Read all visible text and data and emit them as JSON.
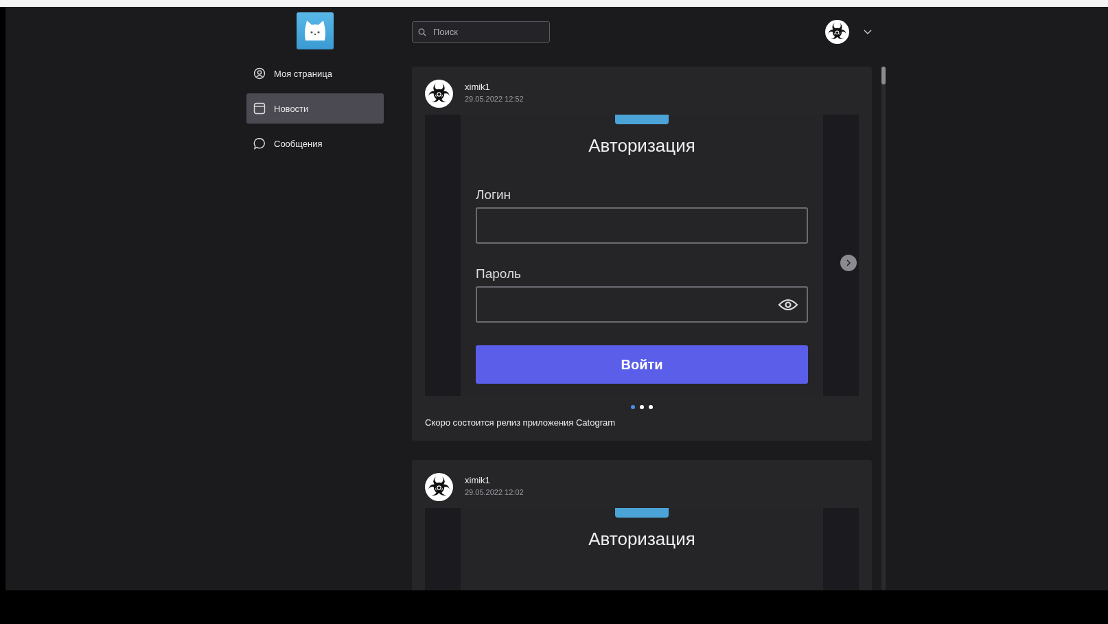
{
  "search": {
    "placeholder": "Поиск"
  },
  "sidebar": {
    "items": [
      {
        "label": "Моя страница",
        "selected": false
      },
      {
        "label": "Новости",
        "selected": true
      },
      {
        "label": "Сообщения",
        "selected": false
      }
    ]
  },
  "posts": [
    {
      "author": "ximik1",
      "date": "29.05.2022 12:52",
      "slide": {
        "title": "Авторизация",
        "fields": [
          {
            "label": "Логин",
            "kind": "text"
          },
          {
            "label": "Пароль",
            "kind": "password"
          }
        ],
        "button": "Войти"
      },
      "dots": [
        {
          "selected": true
        },
        {
          "selected": false
        },
        {
          "selected": false
        }
      ],
      "caption": "Скоро состоится релиз приложения Catogram"
    },
    {
      "author": "ximik1",
      "date": "29.05.2022 12:02",
      "slide": {
        "title": "Авторизация"
      }
    }
  ]
}
